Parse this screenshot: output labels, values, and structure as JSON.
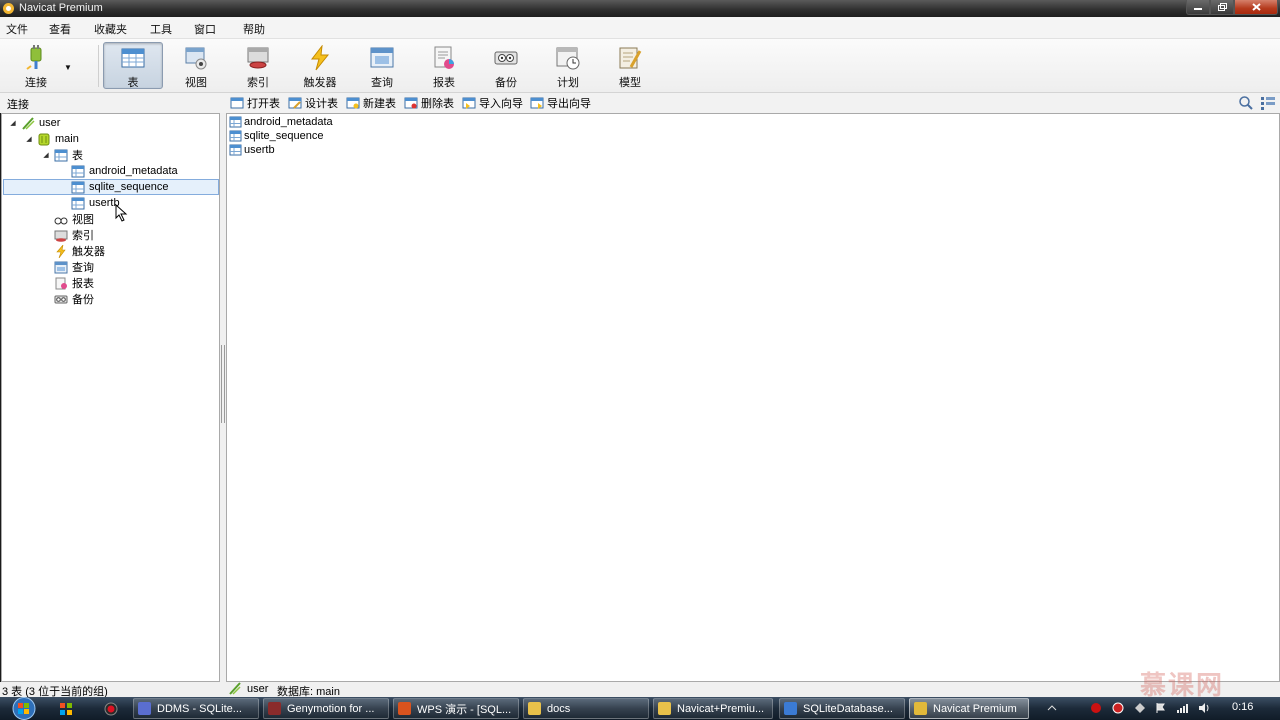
{
  "window": {
    "title": "Navicat Premium"
  },
  "menu": {
    "items": [
      "文件",
      "查看",
      "收藏夹",
      "工具",
      "窗口",
      "帮助"
    ]
  },
  "toolbar": {
    "connect_label": "连接",
    "tools": [
      {
        "label": "表",
        "icon": "table-icon",
        "active": true
      },
      {
        "label": "视图",
        "icon": "view-icon"
      },
      {
        "label": "索引",
        "icon": "index-icon"
      },
      {
        "label": "触发器",
        "icon": "trigger-icon"
      },
      {
        "label": "查询",
        "icon": "query-icon"
      },
      {
        "label": "报表",
        "icon": "report-icon"
      },
      {
        "label": "备份",
        "icon": "backup-icon"
      },
      {
        "label": "计划",
        "icon": "schedule-icon"
      },
      {
        "label": "模型",
        "icon": "model-icon"
      }
    ]
  },
  "left_panel": {
    "header": "连接",
    "tree": {
      "connection": "user",
      "database": "main",
      "tables_group": "表",
      "tables": [
        "android_metadata",
        "sqlite_sequence",
        "usertb"
      ],
      "selected_table": "sqlite_sequence",
      "others": [
        "视图",
        "索引",
        "触发器",
        "查询",
        "报表",
        "备份"
      ]
    }
  },
  "object_toolbar": {
    "buttons": [
      "打开表",
      "设计表",
      "新建表",
      "删除表",
      "导入向导",
      "导出向导"
    ]
  },
  "object_list": [
    "android_metadata",
    "sqlite_sequence",
    "usertb"
  ],
  "statusbar": {
    "count_text": "3 表 (3 位于当前的组)",
    "connection": "user",
    "database": "数据库: main"
  },
  "taskbar": {
    "buttons": [
      {
        "label": "DDMS - SQLite...",
        "color": "#5a6ed0"
      },
      {
        "label": "Genymotion for ...",
        "color": "#8a2b2b"
      },
      {
        "label": "WPS 演示 - [SQL...",
        "color": "#d9531e"
      },
      {
        "label": "docs",
        "color": "#e8c14a"
      },
      {
        "label": "Navicat+Premiu...",
        "color": "#e8c14a"
      },
      {
        "label": "SQLiteDatabase...",
        "color": "#3b7bd4"
      },
      {
        "label": "Navicat Premium",
        "color": "#e2b93a",
        "active": true
      }
    ],
    "clock": "0:16"
  },
  "watermark": "慕课网",
  "colors": {
    "selection": "#e5f0fb",
    "selection_border": "#84acdd",
    "close_button": "#c0411f"
  }
}
